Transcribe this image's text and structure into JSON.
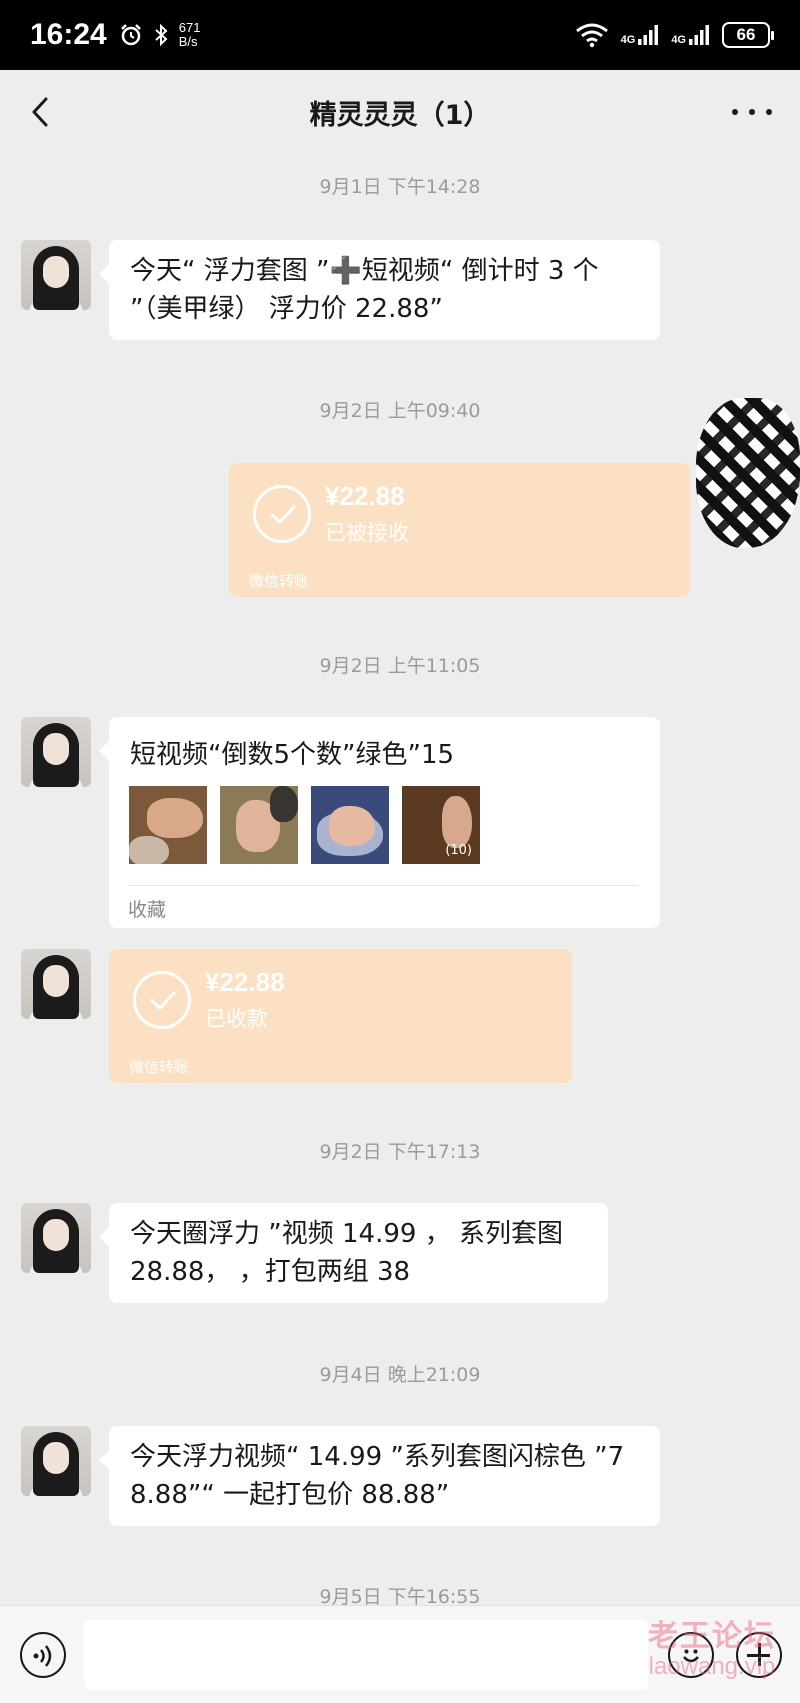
{
  "status_bar": {
    "time": "16:24",
    "net_speed_value": "671",
    "net_speed_unit": "B/s",
    "network_1": "4G",
    "network_2": "4G",
    "battery": "66"
  },
  "header": {
    "title": "精灵灵灵（1）"
  },
  "messages": [
    {
      "type": "timestamp",
      "text": "9月1日 下午14:28"
    },
    {
      "type": "text",
      "side": "left",
      "text": "今天“ 浮力套图 ”➕短视频“ 倒计时 3 个 ”（美甲绿） 浮力价 22.88”"
    },
    {
      "type": "timestamp",
      "text": "9月2日 上午09:40"
    },
    {
      "type": "transfer",
      "side": "right",
      "amount": "¥22.88",
      "status": "已被接收",
      "source": "微信转账"
    },
    {
      "type": "timestamp",
      "text": "9月2日 上午11:05"
    },
    {
      "type": "favorites",
      "side": "left",
      "title": "短视频“倒数5个数”绿色”15",
      "more_count": "(10)",
      "footer": "收藏"
    },
    {
      "type": "transfer",
      "side": "left",
      "amount": "¥22.88",
      "status": "已收款",
      "source": "微信转账"
    },
    {
      "type": "timestamp",
      "text": "9月2日 下午17:13"
    },
    {
      "type": "text",
      "side": "left",
      "text": "今天圈浮力 ”视频 14.99 ， 系列套图 28.88， ，打包两组 38"
    },
    {
      "type": "timestamp",
      "text": "9月4日 晚上21:09"
    },
    {
      "type": "text",
      "side": "left",
      "text": "今天浮力视频“ 14.99 ”系列套图闪棕色 ”78.88”“ 一起打包价 88.88”"
    },
    {
      "type": "timestamp",
      "text": "9月5日 下午16:55"
    }
  ],
  "input_bar": {
    "placeholder": ""
  },
  "watermark": {
    "cn": "老王论坛",
    "en": "laowang.vip"
  },
  "colors": {
    "background": "#ededed",
    "transfer_card": "#fbe0c3",
    "bubble": "#ffffff",
    "status_bar": "#000000"
  }
}
